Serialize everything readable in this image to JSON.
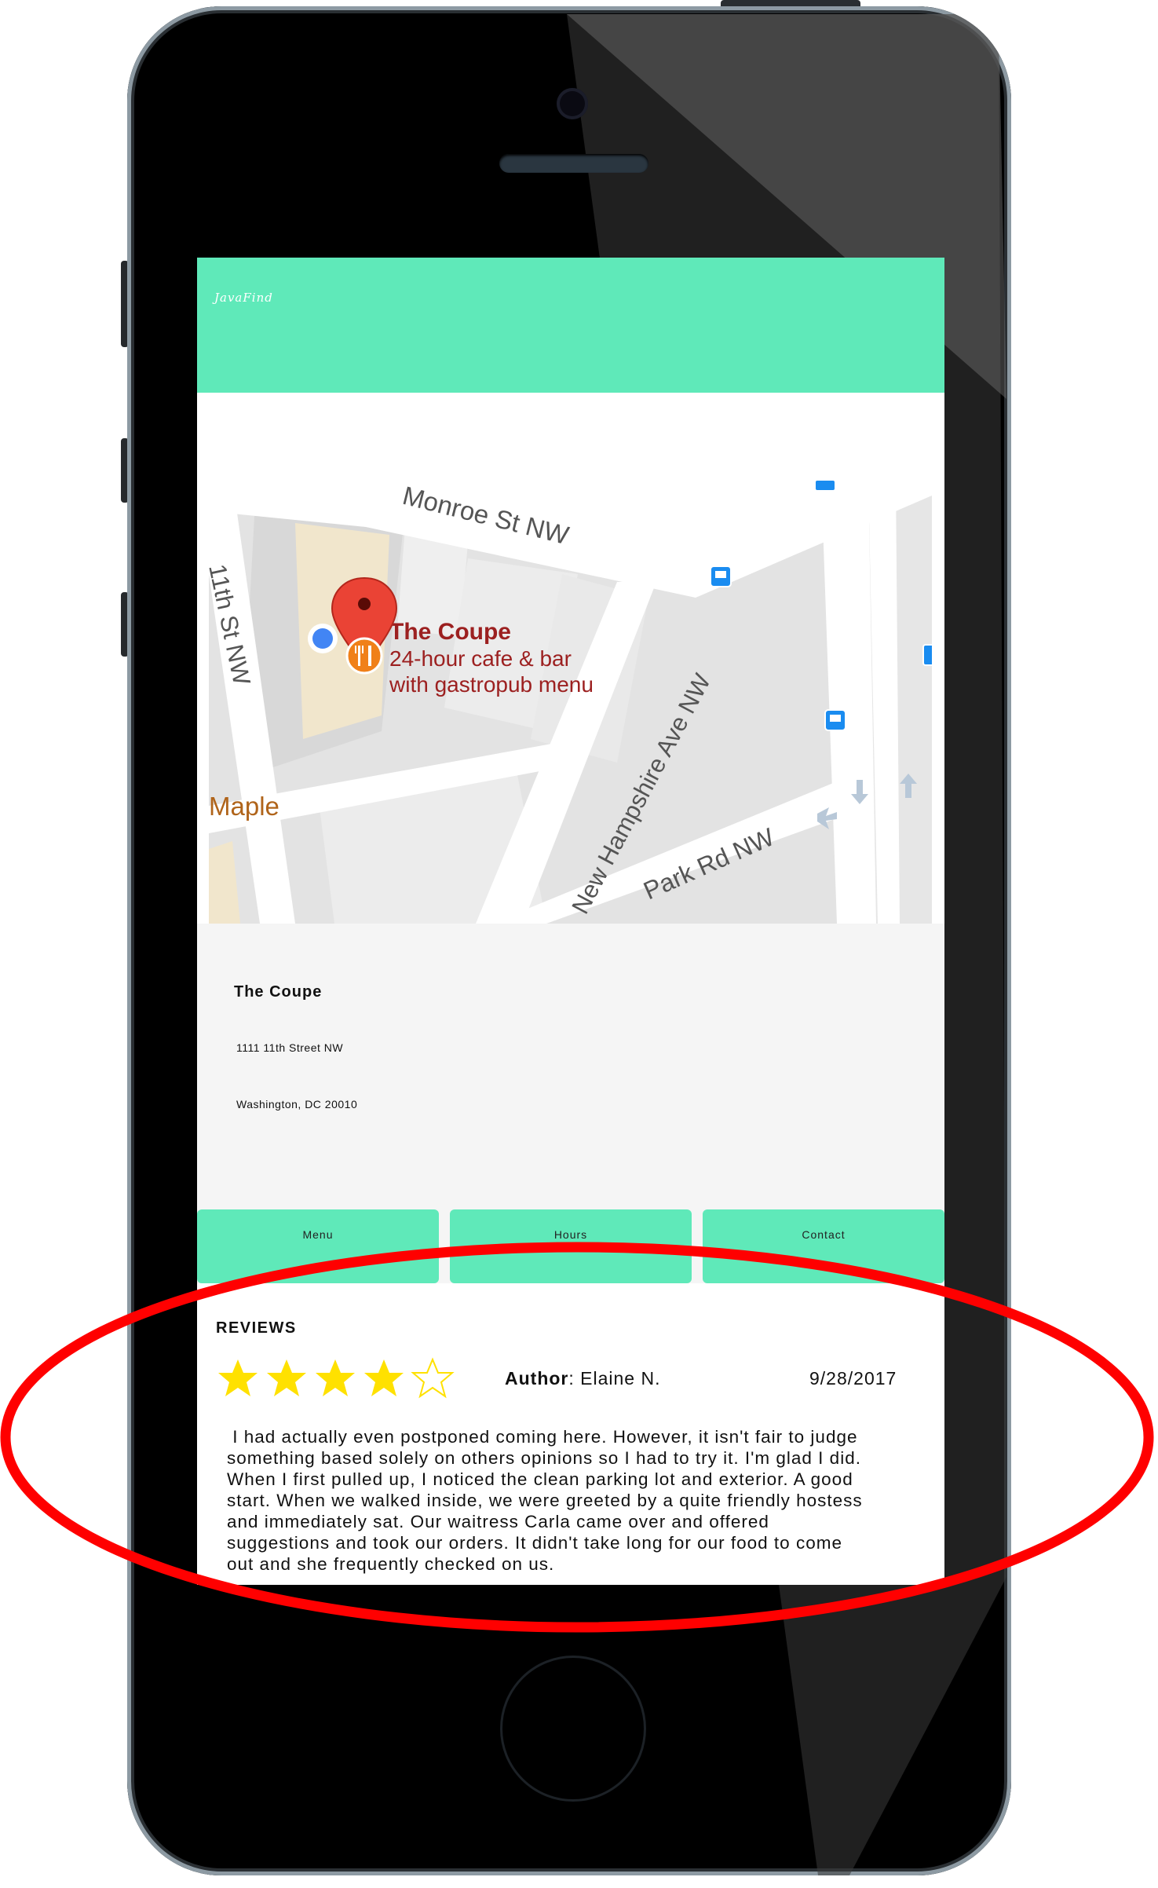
{
  "app": {
    "brand": "JavaFind"
  },
  "map": {
    "place_title": "The Coupe",
    "place_desc_line1": "24-hour cafe & bar",
    "place_desc_line2": "with gastropub menu",
    "street_monroe": "Monroe St NW",
    "street_11th": "11th St NW",
    "street_new_hampshire": "New Hampshire Ave NW",
    "street_park": "Park Rd NW",
    "place_maple": "Maple",
    "icons": [
      "location-pin-icon",
      "restaurant-icon",
      "current-location-dot-icon",
      "bus-stop-icon",
      "direction-arrow-icon"
    ]
  },
  "place": {
    "name": "The Coupe",
    "address_line1": "1111 11th Street NW",
    "address_line2": "Washington, DC 20010"
  },
  "nav": {
    "menu_label": "Menu",
    "hours_label": "Hours",
    "contact_label": "Contact"
  },
  "reviews": {
    "heading": "REVIEWS",
    "rating": 4,
    "rating_max": 5,
    "author_label": "Author",
    "author_name": ": Elaine N.",
    "date": "9/28/2017",
    "text": " I had actually even postponed coming here. However, it isn't fair to judge\nsomething based solely on others opinions so I had to try it. I'm glad I did.\nWhen I first pulled up, I noticed the clean parking lot and exterior. A good\nstart. When we walked inside, we were greeted by a quite friendly hostess\nand immediately sat. Our waitress Carla came over and offered\nsuggestions and took our orders. It didn't take long for our food to come\nout and she frequently checked on us."
  },
  "colors": {
    "accent": "#5fe9b9",
    "star": "#ffe100",
    "annotation": "#ff0000",
    "panel": "#f5f5f5"
  }
}
